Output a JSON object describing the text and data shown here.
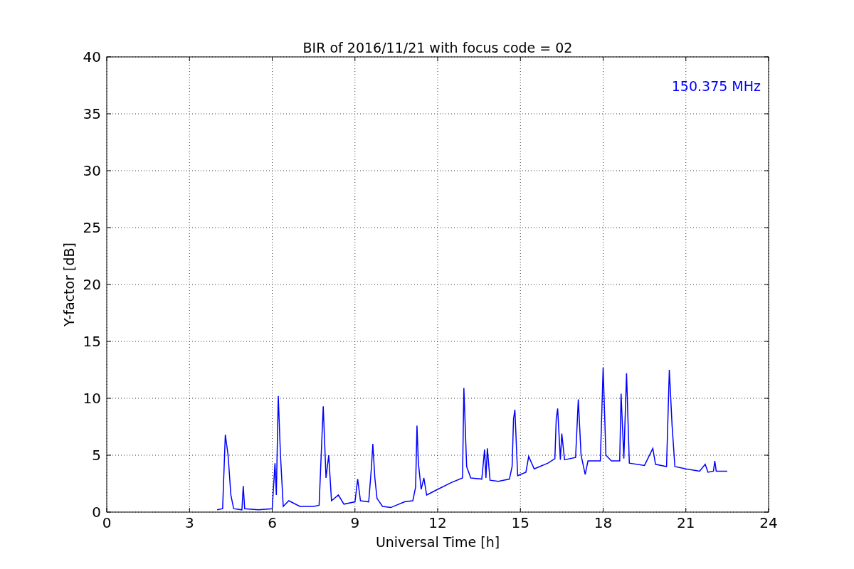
{
  "chart_data": {
    "type": "line",
    "title": "BIR of 2016/11/21 with focus code = 02",
    "xlabel": "Universal Time [h]",
    "ylabel": "Y-factor [dB]",
    "xlim": [
      0,
      24
    ],
    "ylim": [
      0,
      40
    ],
    "xticks": [
      0,
      3,
      6,
      9,
      12,
      15,
      18,
      21,
      24
    ],
    "yticks": [
      0,
      5,
      10,
      15,
      20,
      25,
      30,
      35,
      40
    ],
    "grid": true,
    "x": [
      4.0,
      4.2,
      4.3,
      4.4,
      4.5,
      4.6,
      4.9,
      4.95,
      5.0,
      5.5,
      6.0,
      6.1,
      6.15,
      6.22,
      6.3,
      6.4,
      6.6,
      7.0,
      7.5,
      7.7,
      7.85,
      7.95,
      8.05,
      8.15,
      8.4,
      8.6,
      9.0,
      9.1,
      9.2,
      9.5,
      9.6,
      9.65,
      9.72,
      9.8,
      10.0,
      10.3,
      10.8,
      11.1,
      11.2,
      11.25,
      11.3,
      11.4,
      11.5,
      11.6,
      12.0,
      12.5,
      12.9,
      12.95,
      13.05,
      13.2,
      13.6,
      13.7,
      13.75,
      13.8,
      13.9,
      14.2,
      14.6,
      14.7,
      14.75,
      14.8,
      14.9,
      15.2,
      15.3,
      15.5,
      16.0,
      16.25,
      16.3,
      16.35,
      16.45,
      16.5,
      16.6,
      17.0,
      17.1,
      17.2,
      17.35,
      17.45,
      17.9,
      18.0,
      18.1,
      18.3,
      18.6,
      18.65,
      18.75,
      18.85,
      18.95,
      19.5,
      19.8,
      19.9,
      20.3,
      20.4,
      20.5,
      20.6,
      21.0,
      21.5,
      21.7,
      21.8,
      22.0,
      22.05,
      22.1,
      22.5
    ],
    "series": [
      {
        "name": "150.375 MHz",
        "color": "#0000ff",
        "values": [
          0.2,
          0.3,
          6.8,
          5.0,
          1.5,
          0.3,
          0.2,
          2.3,
          0.3,
          0.2,
          0.3,
          4.3,
          1.5,
          10.2,
          5.0,
          0.5,
          1.0,
          0.5,
          0.5,
          0.6,
          9.3,
          3.0,
          5.0,
          1.0,
          1.5,
          0.7,
          0.9,
          2.9,
          1.0,
          0.9,
          4.0,
          6.0,
          3.0,
          1.2,
          0.5,
          0.4,
          0.9,
          1.0,
          2.2,
          7.6,
          4.3,
          2.0,
          3.0,
          1.5,
          2.0,
          2.6,
          3.0,
          10.9,
          4.0,
          3.0,
          2.9,
          5.5,
          3.0,
          5.6,
          2.8,
          2.7,
          2.9,
          4.0,
          8.2,
          9.0,
          3.2,
          3.5,
          4.9,
          3.8,
          4.3,
          4.7,
          8.2,
          9.1,
          4.6,
          6.9,
          4.6,
          4.8,
          9.9,
          5.0,
          3.3,
          4.5,
          4.5,
          12.7,
          5.0,
          4.5,
          4.5,
          10.4,
          4.7,
          12.2,
          4.3,
          4.1,
          5.6,
          4.2,
          4.0,
          12.5,
          7.6,
          4.0,
          3.8,
          3.6,
          4.2,
          3.5,
          3.6,
          4.5,
          3.6,
          3.6
        ]
      }
    ]
  }
}
